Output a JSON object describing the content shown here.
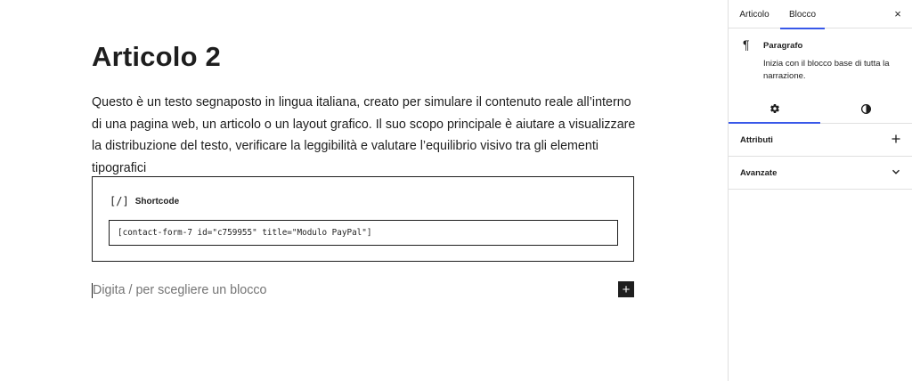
{
  "post": {
    "title": "Articolo 2",
    "paragraph": "Questo è un testo segnaposto in lingua italiana, creato per simulare il contenuto reale all’interno di una pagina web, un articolo o un layout grafico. Il suo scopo principale è aiutare a visualizzare la distribuzione del testo, verificare la leggibilità e valutare l’equilibrio visivo tra gli elementi tipografici"
  },
  "shortcode_block": {
    "icon_glyph": "[/]",
    "label": "Shortcode",
    "value": "[contact-form-7 id=\"c759955\" title=\"Modulo PayPal\"]"
  },
  "appender": {
    "placeholder": "Digita / per scegliere un blocco",
    "add_icon": "+"
  },
  "sidebar": {
    "tabs": [
      {
        "label": "Articolo",
        "active": false
      },
      {
        "label": "Blocco",
        "active": true
      }
    ],
    "close_icon": "×",
    "block_card": {
      "icon_glyph": "¶",
      "title": "Paragrafo",
      "description": "Inizia con il blocco base di tutta la narrazione."
    },
    "sub_tabs": [
      {
        "icon": "gear-icon",
        "active": true
      },
      {
        "icon": "half-circle-styles-icon",
        "active": false
      }
    ],
    "panels": [
      {
        "label": "Attributi",
        "toggle": "plus-icon"
      },
      {
        "label": "Avanzate",
        "toggle": "chevron-down-icon"
      }
    ]
  },
  "colors": {
    "text": "#1e1e1e",
    "accent": "#3858e9",
    "placeholder": "#757575",
    "border": "#e0e0e0"
  }
}
